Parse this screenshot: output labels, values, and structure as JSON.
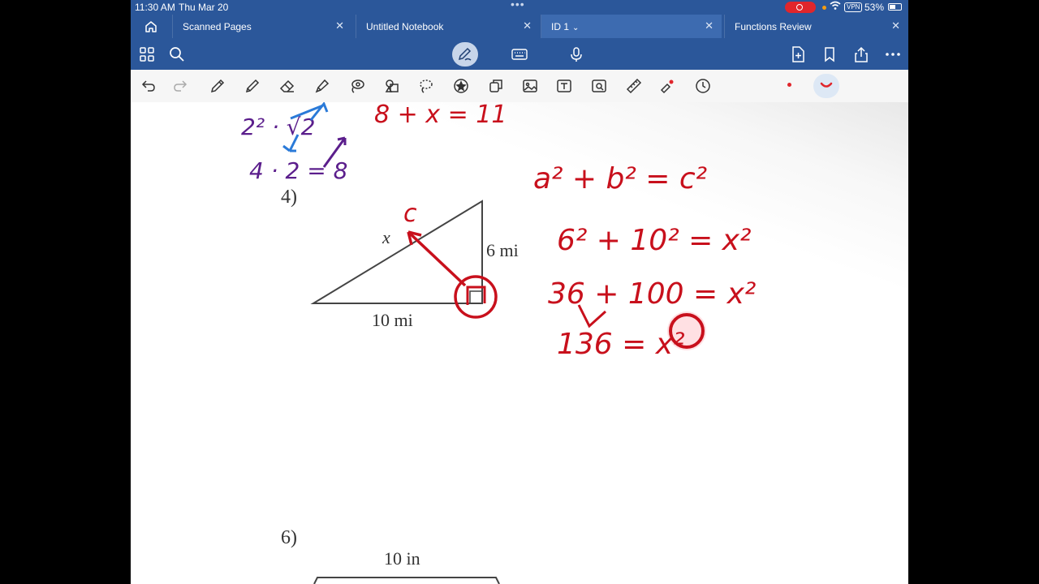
{
  "status_bar": {
    "time": "11:30 AM",
    "date": "Thu Mar 20",
    "vpn": "VPN",
    "battery": "53%"
  },
  "tabs": [
    {
      "label": "Scanned Pages",
      "active": false
    },
    {
      "label": "Untitled Notebook",
      "active": false
    },
    {
      "label": "ID 1",
      "active": true
    },
    {
      "label": "Functions Review",
      "active": false
    }
  ],
  "toolbar": {
    "left_icons": [
      "apps-grid-icon",
      "search-icon"
    ],
    "center_icons": [
      "pen-mode-icon",
      "keyboard-icon",
      "microphone-icon"
    ],
    "right_icons": [
      "add-page-icon",
      "bookmark-icon",
      "share-icon",
      "more-icon"
    ]
  },
  "draw_tools": [
    "undo-icon",
    "redo-icon",
    "pen-icon",
    "pencil-icon",
    "eraser-icon",
    "highlighter-icon",
    "lasso-icon",
    "shapes-icon",
    "lasso-select-icon",
    "sticker-icon",
    "copy-icon",
    "image-icon",
    "text-icon",
    "image-scan-icon",
    "ruler-icon",
    "laser-pointer-icon",
    "timer-icon"
  ],
  "colors": {
    "accent": "#2b579a",
    "ink_red": "#c8101c",
    "ink_purple": "#5b1e8c",
    "ink_blue": "#2a7ad8"
  },
  "worksheet": {
    "problem_4": {
      "number": "4)",
      "hypotenuse_label": "x",
      "side_label": "6 mi",
      "base_label": "10 mi",
      "annotations": {
        "hypotenuse_note": "c",
        "equation_1": "a² + b² = c²",
        "equation_2": "6² + 10² = x²",
        "equation_3": "36 + 100 = x²",
        "equation_4": "136 = x²"
      }
    },
    "previous_work": {
      "line_1": "2² · √2",
      "line_2": "4 · 2 = 8",
      "line_3": "8 + x = 11"
    },
    "problem_6": {
      "number": "6)",
      "top_label": "10 in"
    }
  }
}
